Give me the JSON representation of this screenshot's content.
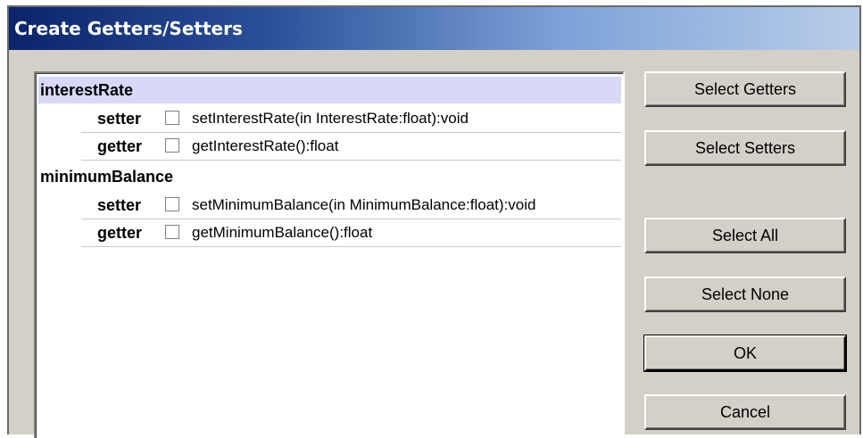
{
  "window": {
    "title": "Create Getters/Setters"
  },
  "list": {
    "groups": [
      {
        "name": "interestRate",
        "items": [
          {
            "kind": "setter",
            "signature": "setInterestRate(in InterestRate:float):void",
            "checked": false
          },
          {
            "kind": "getter",
            "signature": "getInterestRate():float",
            "checked": false
          }
        ]
      },
      {
        "name": "minimumBalance",
        "items": [
          {
            "kind": "setter",
            "signature": "setMinimumBalance(in MinimumBalance:float):void",
            "checked": false
          },
          {
            "kind": "getter",
            "signature": "getMinimumBalance():float",
            "checked": false
          }
        ]
      }
    ]
  },
  "buttons": {
    "select_getters": "Select Getters",
    "select_setters": "Select Setters",
    "select_all": "Select All",
    "select_none": "Select None",
    "ok": "OK",
    "cancel": "Cancel"
  }
}
